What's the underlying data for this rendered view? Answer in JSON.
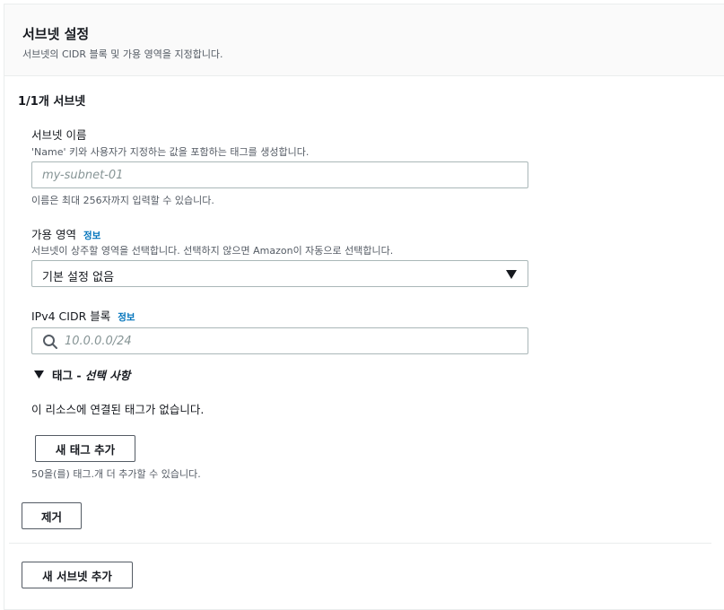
{
  "header": {
    "title": "서브넷 설정",
    "description": "서브넷의 CIDR 블록 및 가용 영역을 지정합니다."
  },
  "section": {
    "title": "1/1개 서브넷"
  },
  "subnet_name": {
    "label": "서브넷 이름",
    "description": "'Name' 키와 사용자가 지정하는 값을 포함하는 태그를 생성합니다.",
    "placeholder": "my-subnet-01",
    "value": "",
    "hint": "이름은 최대 256자까지 입력할 수 있습니다."
  },
  "availability_zone": {
    "label": "가용 영역",
    "info": "정보",
    "description": "서브넷이 상주할 영역을 선택합니다. 선택하지 않으면 Amazon이 자동으로 선택합니다.",
    "selected": "기본 설정 없음"
  },
  "cidr": {
    "label": "IPv4 CIDR 블록",
    "info": "정보",
    "placeholder": "10.0.0.0/24",
    "value": ""
  },
  "tags": {
    "title": "태그 -",
    "optional": "선택 사항",
    "empty_text": "이 리소스에 연결된 태그가 없습니다.",
    "add_button": "새 태그 추가",
    "limit_hint": "50을(를) 태그.개 더 추가할 수 있습니다."
  },
  "buttons": {
    "remove": "제거",
    "add_subnet": "새 서브넷 추가"
  },
  "colors": {
    "link": "#0073bb",
    "border": "#aab7b8",
    "header_bg": "#fafafa"
  },
  "icons": {
    "search": "search-icon",
    "dropdown": "caret-down-icon",
    "expand": "triangle-down-icon"
  }
}
